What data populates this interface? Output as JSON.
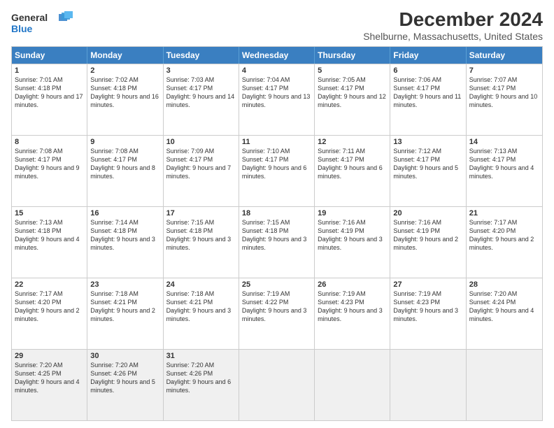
{
  "logo": {
    "line1": "General",
    "line2": "Blue"
  },
  "title": "December 2024",
  "subtitle": "Shelburne, Massachusetts, United States",
  "header_days": [
    "Sunday",
    "Monday",
    "Tuesday",
    "Wednesday",
    "Thursday",
    "Friday",
    "Saturday"
  ],
  "weeks": [
    [
      {
        "day": "1",
        "sunrise": "7:01 AM",
        "sunset": "4:18 PM",
        "daylight": "9 hours and 17 minutes."
      },
      {
        "day": "2",
        "sunrise": "7:02 AM",
        "sunset": "4:18 PM",
        "daylight": "9 hours and 16 minutes."
      },
      {
        "day": "3",
        "sunrise": "7:03 AM",
        "sunset": "4:17 PM",
        "daylight": "9 hours and 14 minutes."
      },
      {
        "day": "4",
        "sunrise": "7:04 AM",
        "sunset": "4:17 PM",
        "daylight": "9 hours and 13 minutes."
      },
      {
        "day": "5",
        "sunrise": "7:05 AM",
        "sunset": "4:17 PM",
        "daylight": "9 hours and 12 minutes."
      },
      {
        "day": "6",
        "sunrise": "7:06 AM",
        "sunset": "4:17 PM",
        "daylight": "9 hours and 11 minutes."
      },
      {
        "day": "7",
        "sunrise": "7:07 AM",
        "sunset": "4:17 PM",
        "daylight": "9 hours and 10 minutes."
      }
    ],
    [
      {
        "day": "8",
        "sunrise": "7:08 AM",
        "sunset": "4:17 PM",
        "daylight": "9 hours and 9 minutes."
      },
      {
        "day": "9",
        "sunrise": "7:08 AM",
        "sunset": "4:17 PM",
        "daylight": "9 hours and 8 minutes."
      },
      {
        "day": "10",
        "sunrise": "7:09 AM",
        "sunset": "4:17 PM",
        "daylight": "9 hours and 7 minutes."
      },
      {
        "day": "11",
        "sunrise": "7:10 AM",
        "sunset": "4:17 PM",
        "daylight": "9 hours and 6 minutes."
      },
      {
        "day": "12",
        "sunrise": "7:11 AM",
        "sunset": "4:17 PM",
        "daylight": "9 hours and 6 minutes."
      },
      {
        "day": "13",
        "sunrise": "7:12 AM",
        "sunset": "4:17 PM",
        "daylight": "9 hours and 5 minutes."
      },
      {
        "day": "14",
        "sunrise": "7:13 AM",
        "sunset": "4:17 PM",
        "daylight": "9 hours and 4 minutes."
      }
    ],
    [
      {
        "day": "15",
        "sunrise": "7:13 AM",
        "sunset": "4:18 PM",
        "daylight": "9 hours and 4 minutes."
      },
      {
        "day": "16",
        "sunrise": "7:14 AM",
        "sunset": "4:18 PM",
        "daylight": "9 hours and 3 minutes."
      },
      {
        "day": "17",
        "sunrise": "7:15 AM",
        "sunset": "4:18 PM",
        "daylight": "9 hours and 3 minutes."
      },
      {
        "day": "18",
        "sunrise": "7:15 AM",
        "sunset": "4:18 PM",
        "daylight": "9 hours and 3 minutes."
      },
      {
        "day": "19",
        "sunrise": "7:16 AM",
        "sunset": "4:19 PM",
        "daylight": "9 hours and 3 minutes."
      },
      {
        "day": "20",
        "sunrise": "7:16 AM",
        "sunset": "4:19 PM",
        "daylight": "9 hours and 2 minutes."
      },
      {
        "day": "21",
        "sunrise": "7:17 AM",
        "sunset": "4:20 PM",
        "daylight": "9 hours and 2 minutes."
      }
    ],
    [
      {
        "day": "22",
        "sunrise": "7:17 AM",
        "sunset": "4:20 PM",
        "daylight": "9 hours and 2 minutes."
      },
      {
        "day": "23",
        "sunrise": "7:18 AM",
        "sunset": "4:21 PM",
        "daylight": "9 hours and 2 minutes."
      },
      {
        "day": "24",
        "sunrise": "7:18 AM",
        "sunset": "4:21 PM",
        "daylight": "9 hours and 3 minutes."
      },
      {
        "day": "25",
        "sunrise": "7:19 AM",
        "sunset": "4:22 PM",
        "daylight": "9 hours and 3 minutes."
      },
      {
        "day": "26",
        "sunrise": "7:19 AM",
        "sunset": "4:23 PM",
        "daylight": "9 hours and 3 minutes."
      },
      {
        "day": "27",
        "sunrise": "7:19 AM",
        "sunset": "4:23 PM",
        "daylight": "9 hours and 3 minutes."
      },
      {
        "day": "28",
        "sunrise": "7:20 AM",
        "sunset": "4:24 PM",
        "daylight": "9 hours and 4 minutes."
      }
    ],
    [
      {
        "day": "29",
        "sunrise": "7:20 AM",
        "sunset": "4:25 PM",
        "daylight": "9 hours and 4 minutes."
      },
      {
        "day": "30",
        "sunrise": "7:20 AM",
        "sunset": "4:26 PM",
        "daylight": "9 hours and 5 minutes."
      },
      {
        "day": "31",
        "sunrise": "7:20 AM",
        "sunset": "4:26 PM",
        "daylight": "9 hours and 6 minutes."
      },
      null,
      null,
      null,
      null
    ]
  ],
  "labels": {
    "sunrise": "Sunrise:",
    "sunset": "Sunset:",
    "daylight": "Daylight:"
  }
}
